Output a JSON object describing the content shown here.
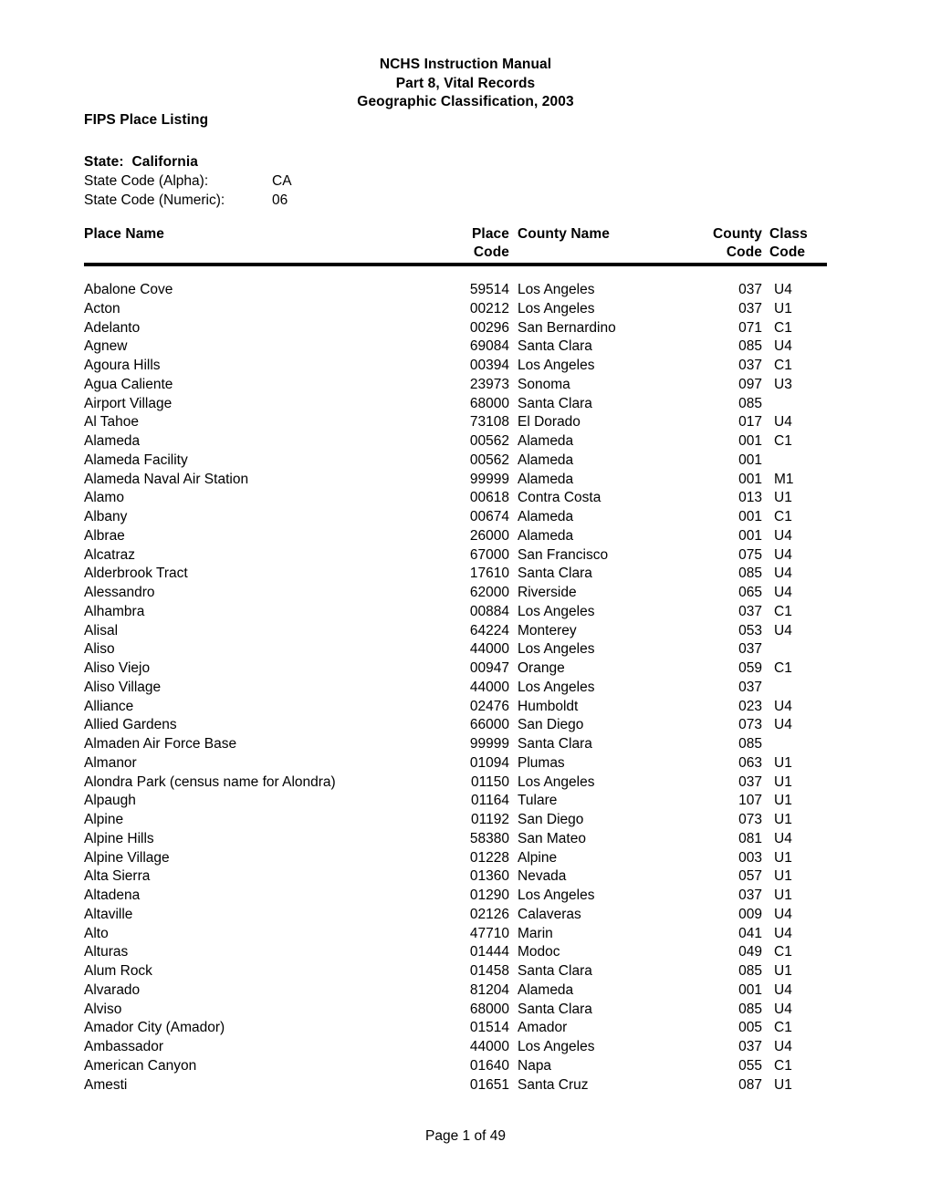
{
  "document": {
    "title_lines": [
      "NCHS Instruction Manual",
      "Part 8, Vital Records",
      "Geographic Classification, 2003"
    ],
    "listing_label": "FIPS Place Listing",
    "footer": "Page 1 of 49"
  },
  "state": {
    "name_line": "State:  California",
    "alpha_label": "State Code (Alpha):",
    "alpha_value": "CA",
    "numeric_label": "State Code (Numeric):",
    "numeric_value": "06"
  },
  "table": {
    "headers": {
      "place_name": "Place Name",
      "place_code_l1": "Place",
      "place_code_l2": "Code",
      "county_name": "County Name",
      "county_code_l1": "County",
      "county_code_l2": "Code",
      "class_code_l1": "Class",
      "class_code_l2": "Code"
    },
    "rows": [
      {
        "place_name": "Abalone Cove",
        "place_code": "59514",
        "county_name": "Los Angeles",
        "county_code": "037",
        "class_code": "U4"
      },
      {
        "place_name": "Acton",
        "place_code": "00212",
        "county_name": "Los Angeles",
        "county_code": "037",
        "class_code": "U1"
      },
      {
        "place_name": "Adelanto",
        "place_code": "00296",
        "county_name": "San Bernardino",
        "county_code": "071",
        "class_code": "C1"
      },
      {
        "place_name": "Agnew",
        "place_code": "69084",
        "county_name": "Santa Clara",
        "county_code": "085",
        "class_code": "U4"
      },
      {
        "place_name": "Agoura Hills",
        "place_code": "00394",
        "county_name": "Los Angeles",
        "county_code": "037",
        "class_code": "C1"
      },
      {
        "place_name": "Agua Caliente",
        "place_code": "23973",
        "county_name": "Sonoma",
        "county_code": "097",
        "class_code": "U3"
      },
      {
        "place_name": "Airport Village",
        "place_code": "68000",
        "county_name": "Santa Clara",
        "county_code": "085",
        "class_code": ""
      },
      {
        "place_name": "Al Tahoe",
        "place_code": "73108",
        "county_name": "El Dorado",
        "county_code": "017",
        "class_code": "U4"
      },
      {
        "place_name": "Alameda",
        "place_code": "00562",
        "county_name": "Alameda",
        "county_code": "001",
        "class_code": "C1"
      },
      {
        "place_name": "Alameda Facility",
        "place_code": "00562",
        "county_name": "Alameda",
        "county_code": "001",
        "class_code": ""
      },
      {
        "place_name": "Alameda Naval Air Station",
        "place_code": "99999",
        "county_name": "Alameda",
        "county_code": "001",
        "class_code": "M1"
      },
      {
        "place_name": "Alamo",
        "place_code": "00618",
        "county_name": "Contra Costa",
        "county_code": "013",
        "class_code": "U1"
      },
      {
        "place_name": "Albany",
        "place_code": "00674",
        "county_name": "Alameda",
        "county_code": "001",
        "class_code": "C1"
      },
      {
        "place_name": "Albrae",
        "place_code": "26000",
        "county_name": "Alameda",
        "county_code": "001",
        "class_code": "U4"
      },
      {
        "place_name": "Alcatraz",
        "place_code": "67000",
        "county_name": "San Francisco",
        "county_code": "075",
        "class_code": "U4"
      },
      {
        "place_name": "Alderbrook Tract",
        "place_code": "17610",
        "county_name": "Santa Clara",
        "county_code": "085",
        "class_code": "U4"
      },
      {
        "place_name": "Alessandro",
        "place_code": "62000",
        "county_name": "Riverside",
        "county_code": "065",
        "class_code": "U4"
      },
      {
        "place_name": "Alhambra",
        "place_code": "00884",
        "county_name": "Los Angeles",
        "county_code": "037",
        "class_code": "C1"
      },
      {
        "place_name": "Alisal",
        "place_code": "64224",
        "county_name": "Monterey",
        "county_code": "053",
        "class_code": "U4"
      },
      {
        "place_name": "Aliso",
        "place_code": "44000",
        "county_name": "Los Angeles",
        "county_code": "037",
        "class_code": ""
      },
      {
        "place_name": "Aliso Viejo",
        "place_code": "00947",
        "county_name": "Orange",
        "county_code": "059",
        "class_code": "C1"
      },
      {
        "place_name": "Aliso Village",
        "place_code": "44000",
        "county_name": "Los Angeles",
        "county_code": "037",
        "class_code": ""
      },
      {
        "place_name": "Alliance",
        "place_code": "02476",
        "county_name": "Humboldt",
        "county_code": "023",
        "class_code": "U4"
      },
      {
        "place_name": "Allied Gardens",
        "place_code": "66000",
        "county_name": "San Diego",
        "county_code": "073",
        "class_code": "U4"
      },
      {
        "place_name": "Almaden Air Force Base",
        "place_code": "99999",
        "county_name": "Santa Clara",
        "county_code": "085",
        "class_code": ""
      },
      {
        "place_name": "Almanor",
        "place_code": "01094",
        "county_name": "Plumas",
        "county_code": "063",
        "class_code": "U1"
      },
      {
        "place_name": "Alondra Park (census name for Alondra)",
        "place_code": "01150",
        "county_name": "Los Angeles",
        "county_code": "037",
        "class_code": "U1"
      },
      {
        "place_name": "Alpaugh",
        "place_code": "01164",
        "county_name": "Tulare",
        "county_code": "107",
        "class_code": "U1"
      },
      {
        "place_name": "Alpine",
        "place_code": "01192",
        "county_name": "San Diego",
        "county_code": "073",
        "class_code": "U1"
      },
      {
        "place_name": "Alpine Hills",
        "place_code": "58380",
        "county_name": "San Mateo",
        "county_code": "081",
        "class_code": "U4"
      },
      {
        "place_name": "Alpine Village",
        "place_code": "01228",
        "county_name": "Alpine",
        "county_code": "003",
        "class_code": "U1"
      },
      {
        "place_name": "Alta Sierra",
        "place_code": "01360",
        "county_name": "Nevada",
        "county_code": "057",
        "class_code": "U1"
      },
      {
        "place_name": "Altadena",
        "place_code": "01290",
        "county_name": "Los Angeles",
        "county_code": "037",
        "class_code": "U1"
      },
      {
        "place_name": "Altaville",
        "place_code": "02126",
        "county_name": "Calaveras",
        "county_code": "009",
        "class_code": "U4"
      },
      {
        "place_name": "Alto",
        "place_code": "47710",
        "county_name": "Marin",
        "county_code": "041",
        "class_code": "U4"
      },
      {
        "place_name": "Alturas",
        "place_code": "01444",
        "county_name": "Modoc",
        "county_code": "049",
        "class_code": "C1"
      },
      {
        "place_name": "Alum Rock",
        "place_code": "01458",
        "county_name": "Santa Clara",
        "county_code": "085",
        "class_code": "U1"
      },
      {
        "place_name": "Alvarado",
        "place_code": "81204",
        "county_name": "Alameda",
        "county_code": "001",
        "class_code": "U4"
      },
      {
        "place_name": "Alviso",
        "place_code": "68000",
        "county_name": "Santa Clara",
        "county_code": "085",
        "class_code": "U4"
      },
      {
        "place_name": "Amador City (Amador)",
        "place_code": "01514",
        "county_name": "Amador",
        "county_code": "005",
        "class_code": "C1"
      },
      {
        "place_name": "Ambassador",
        "place_code": "44000",
        "county_name": "Los Angeles",
        "county_code": "037",
        "class_code": "U4"
      },
      {
        "place_name": "American Canyon",
        "place_code": "01640",
        "county_name": "Napa",
        "county_code": "055",
        "class_code": "C1"
      },
      {
        "place_name": "Amesti",
        "place_code": "01651",
        "county_name": "Santa Cruz",
        "county_code": "087",
        "class_code": "U1"
      }
    ]
  }
}
